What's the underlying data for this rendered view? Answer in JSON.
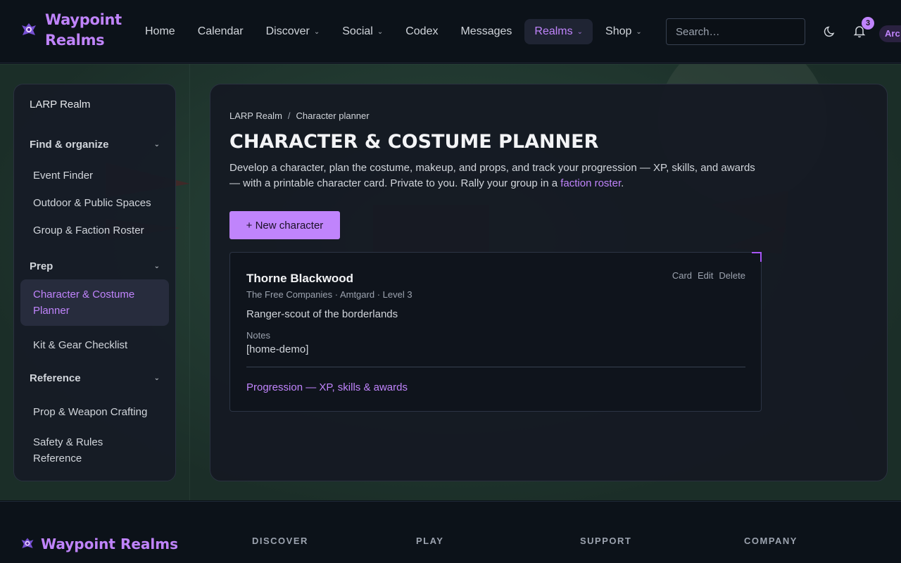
{
  "brand": {
    "name": "Waypoint Realms",
    "accent": "#c084fc"
  },
  "nav": {
    "items": [
      {
        "label": "Home",
        "dropdown": false
      },
      {
        "label": "Calendar",
        "dropdown": false
      },
      {
        "label": "Discover",
        "dropdown": true
      },
      {
        "label": "Social",
        "dropdown": true
      },
      {
        "label": "Codex",
        "dropdown": false
      },
      {
        "label": "Messages",
        "dropdown": false
      },
      {
        "label": "Realms",
        "dropdown": true,
        "active": true
      },
      {
        "label": "Shop",
        "dropdown": true
      }
    ],
    "search_placeholder": "Search…",
    "notification_count": "3",
    "user_chip": "Arc"
  },
  "sidebar": {
    "title": "LARP Realm",
    "sections": [
      {
        "label": "Find & organize",
        "items": [
          "Event Finder",
          "Outdoor & Public Spaces",
          "Group & Faction Roster"
        ]
      },
      {
        "label": "Prep",
        "items": [
          "Character & Costume Planner",
          "Kit & Gear Checklist"
        ],
        "active_item": "Character & Costume Planner"
      },
      {
        "label": "Reference",
        "items": [
          "Prop & Weapon Crafting",
          "Safety & Rules Reference"
        ]
      }
    ]
  },
  "main": {
    "breadcrumb": [
      "LARP Realm",
      "Character planner"
    ],
    "breadcrumb_sep": "/",
    "title": "CHARACTER & COSTUME PLANNER",
    "intro_text": "Develop a character, plan the costume, makeup, and props, and track your progression — XP, skills, and awards — with a printable character card. Private to you. Rally your group in a ",
    "intro_link": "faction roster",
    "intro_end": ".",
    "new_button": "+ New character",
    "character": {
      "name": "Thorne Blackwood",
      "meta": "The Free Companies · Amtgard · Level 3",
      "description": "Ranger-scout of the borderlands",
      "notes_label": "Notes",
      "notes_value": "[home-demo]",
      "progression_link": "Progression — XP, skills & awards",
      "actions": [
        "Card",
        "Edit",
        "Delete"
      ]
    }
  },
  "footer": {
    "brand": "Waypoint Realms",
    "columns": [
      "DISCOVER",
      "PLAY",
      "SUPPORT",
      "COMPANY"
    ]
  }
}
